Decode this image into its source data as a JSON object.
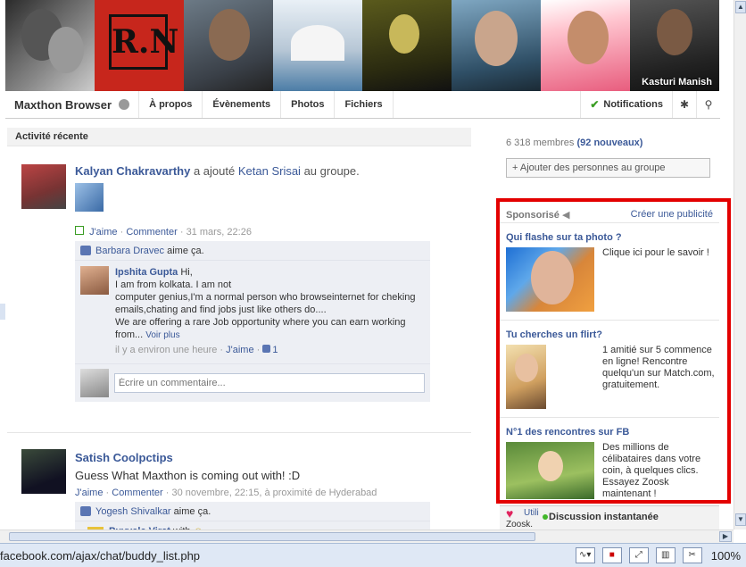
{
  "cover": {
    "tile_name": "Kasturi Manish",
    "logo_text": "R.N"
  },
  "tabs": {
    "group_name": "Maxthon Browser",
    "items": [
      "À propos",
      "Évènements",
      "Photos",
      "Fichiers"
    ],
    "notifications": "Notifications"
  },
  "feed": {
    "section_title": "Activité récente",
    "post1": {
      "author": "Kalyan Chakravarthy",
      "action": "a ajouté",
      "target": "Ketan Srisai",
      "suffix": "au groupe.",
      "like": "J'aime",
      "comment": "Commenter",
      "time": "· 31 mars, 22:26",
      "liked_by": "Barbara Dravec",
      "liked_suffix": "aime ça.",
      "c_name": "Ipshita Gupta",
      "c_line1": "Hi,",
      "c_line2": "I am from kolkata. I am not",
      "c_line3": "computer genius,I'm a normal person who browseinternet for cheking",
      "c_line4": "emails,chating and find jobs just like others do....",
      "c_line5": "We are offering a rare Job opportunity where you can earn working",
      "c_line6": "from...",
      "see_more": "Voir plus",
      "c_meta": "il y a environ une heure ·",
      "c_like": "J'aime",
      "c_like_count": "1",
      "write_placeholder": "Écrire un commentaire..."
    },
    "post2": {
      "author": "Satish Coolpctips",
      "text": "Guess What Maxthon is coming out with! :D",
      "like": "J'aime",
      "comment": "Commenter",
      "time": "· 30 novembre, 22:15, à proximité de Hyderabad",
      "liked_by": "Yogesh Shivalkar",
      "liked_suffix": "aime ça.",
      "next_name": "Puvvala Virat",
      "next_suffix": "with"
    }
  },
  "sidebar": {
    "members": "6 318 membres",
    "new_members": "(92 nouveaux)",
    "add_people": "+ Ajouter des personnes au groupe",
    "sponsored": "Sponsorisé",
    "create_ad": "Créer une publicité",
    "ads": [
      {
        "title": "Qui flashe sur ta photo ?",
        "text": "Clique ici pour le savoir !"
      },
      {
        "title": "Tu cherches un flirt?",
        "text": "1 amitié sur 5 commence en ligne! Rencontre quelqu'un sur Match.com, gratuitement."
      },
      {
        "title": "N°1 des rencontres sur FB",
        "text": "Des millions de célibataires dans votre coin, à quelques clics. Essayez Zoosk maintenant !"
      }
    ],
    "chat_util": "Utili",
    "chat_zoosk": "Zoosk.",
    "chat_label": "Discussion instantanée"
  },
  "status": {
    "url": "facebook.com/ajax/chat/buddy_list.php",
    "zoom": "100%"
  },
  "colors": {
    "link": "#3b5998",
    "highlight": "#e30000",
    "status_bar": "#dfe8f5"
  }
}
